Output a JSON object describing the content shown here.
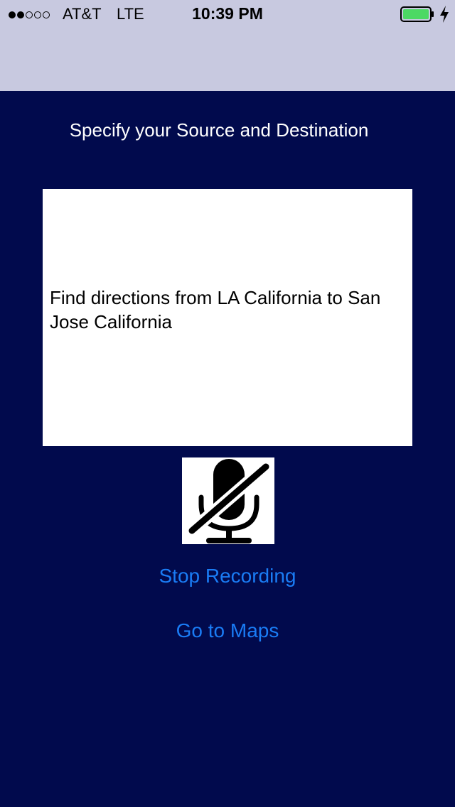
{
  "status_bar": {
    "signal_strength": 2,
    "signal_max": 5,
    "carrier": "AT&T",
    "network": "LTE",
    "time": "10:39 PM",
    "battery_level": 1.0,
    "battery_color": "#4cd964",
    "icons": [
      "signal-dots-icon",
      "battery-icon",
      "charging-bolt-icon"
    ]
  },
  "main": {
    "heading": "Specify your Source and Destination",
    "transcript": "Find directions from LA California to San Jose California",
    "mic_icon": "microphone-slash-icon",
    "stop_recording_label": "Stop Recording",
    "go_to_maps_label": "Go to Maps"
  },
  "colors": {
    "background": "#010a4d",
    "status_bar": "#c8c9e0",
    "link": "#1a7cf5"
  }
}
